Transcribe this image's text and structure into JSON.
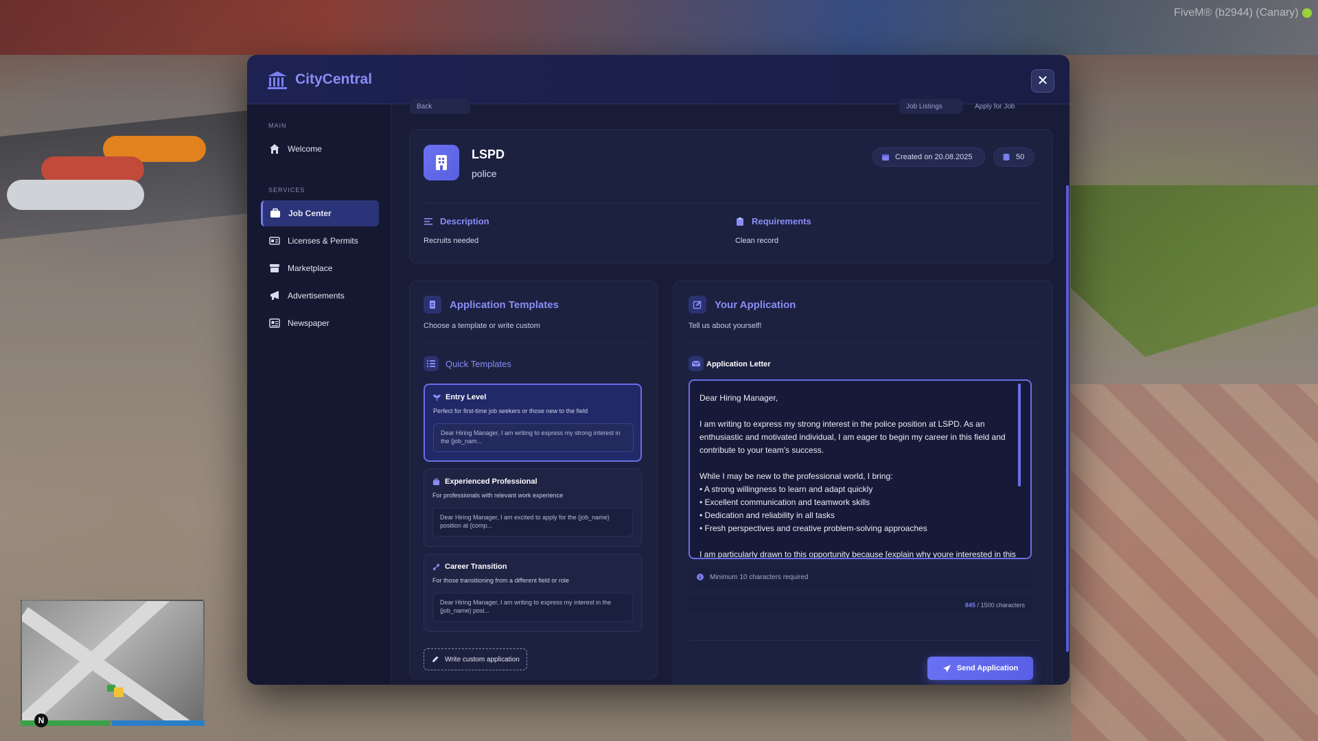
{
  "game_overlay": {
    "build_tag": "FiveM® (b2944) (Canary)",
    "compass": "N"
  },
  "app": {
    "title": "CityCentral",
    "close_label": "✕"
  },
  "sidebar": {
    "sections": [
      {
        "label": "MAIN",
        "items": [
          {
            "label": "Welcome",
            "icon": "home-icon"
          }
        ]
      },
      {
        "label": "SERVICES",
        "items": [
          {
            "label": "Job Center",
            "icon": "briefcase-icon",
            "active": true
          },
          {
            "label": "Licenses & Permits",
            "icon": "id-card-icon"
          },
          {
            "label": "Marketplace",
            "icon": "store-icon"
          },
          {
            "label": "Advertisements",
            "icon": "megaphone-icon"
          },
          {
            "label": "Newspaper",
            "icon": "newspaper-icon"
          }
        ]
      }
    ]
  },
  "breadcrumb": {
    "back": "Back",
    "listings": "Job Listings",
    "apply": "Apply for Job"
  },
  "job": {
    "name": "LSPD",
    "category": "police",
    "created": "Created on 20.08.2025",
    "count": "50",
    "description_label": "Description",
    "description": "Recruits needed",
    "requirements_label": "Requirements",
    "requirements": "Clean record"
  },
  "templates_panel": {
    "title": "Application Templates",
    "subtitle": "Choose a template or write custom",
    "quick_label": "Quick Templates",
    "items": [
      {
        "title": "Entry Level",
        "desc": "Perfect for first-time job seekers or those new to the field",
        "preview": "Dear Hiring Manager, I am writing to express my strong interest in the {job_nam...",
        "active": true
      },
      {
        "title": "Experienced Professional",
        "desc": "For professionals with relevant work experience",
        "preview": "Dear Hiring Manager, I am excited to apply for the {job_name} position at {comp..."
      },
      {
        "title": "Career Transition",
        "desc": "For those transitioning from a different field or role",
        "preview": "Dear Hiring Manager, I am writing to express my interest in the {job_name} posi..."
      }
    ],
    "custom_label": "Write custom application"
  },
  "application_panel": {
    "title": "Your Application",
    "subtitle": "Tell us about yourself!",
    "letter_label": "Application Letter",
    "letter": "Dear Hiring Manager,\n\nI am writing to express my strong interest in the police position at LSPD. As an enthusiastic and motivated individual, I am eager to begin my career in this field and contribute to your team's success.\n\nWhile I may be new to the professional world, I bring:\n• A strong willingness to learn and adapt quickly\n• Excellent communication and teamwork skills\n• Dedication and reliability in all tasks\n• Fresh perspectives and creative problem-solving approaches\n\nI am particularly drawn to this opportunity because [explain why youre interested in this",
    "hint": "Minimum 10 characters required",
    "char_count": "845",
    "char_limit_text": "/ 1500 characters",
    "send_label": "Send Application"
  },
  "colors": {
    "accent": "#7b7ff0",
    "modal_bg": "#161a33",
    "active_nav": "#2b3478"
  }
}
